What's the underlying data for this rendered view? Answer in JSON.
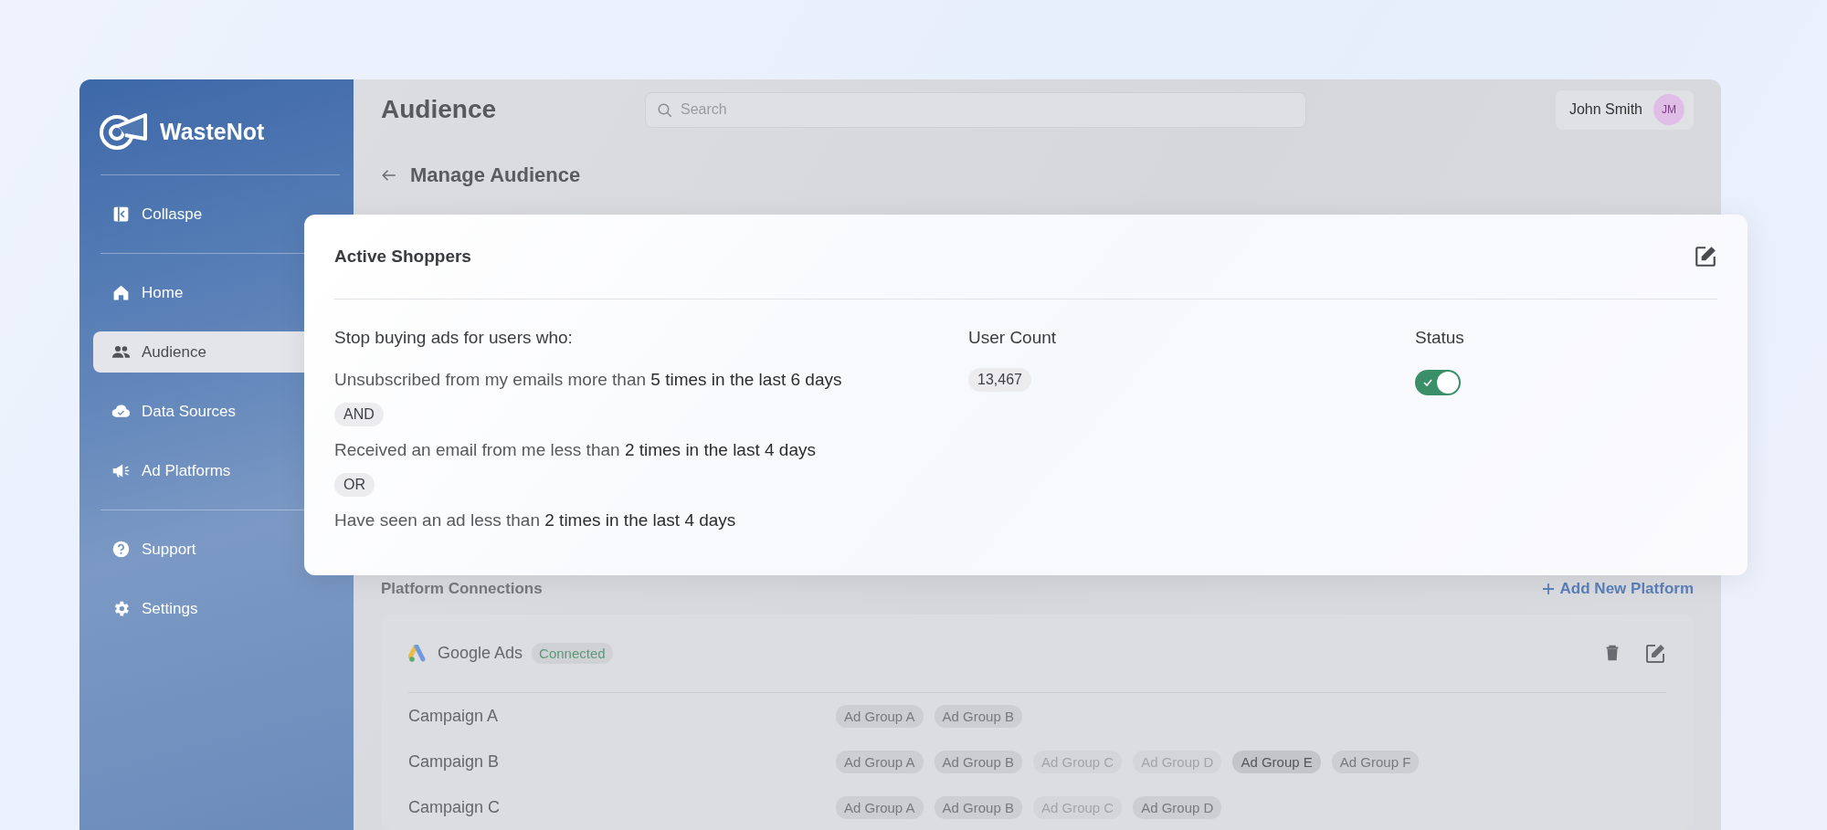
{
  "sidebar": {
    "brand": "WasteNot",
    "collapse": "Collaspe",
    "nav_groups": [
      {
        "items": [
          {
            "label": "Home",
            "kind": "home",
            "selected": false
          },
          {
            "label": "Audience",
            "kind": "people",
            "selected": true
          },
          {
            "label": "Data Sources",
            "kind": "cloud",
            "selected": false
          },
          {
            "label": "Ad Platforms",
            "kind": "megaphone",
            "selected": false
          }
        ]
      },
      {
        "items": [
          {
            "label": "Support",
            "kind": "help",
            "selected": false
          },
          {
            "label": "Settings",
            "kind": "gear",
            "selected": false
          }
        ]
      }
    ]
  },
  "header": {
    "title": "Audience",
    "search": {
      "placeholder": "Search"
    },
    "user": {
      "name": "John Smith",
      "initials": "JM"
    }
  },
  "subheader": {
    "title": "Manage Audience"
  },
  "audience_card": {
    "title": "Active Shoppers",
    "columns": [
      "Stop buying ads for users who:",
      "User Count",
      "Status"
    ],
    "rules": [
      {
        "kind": "rule",
        "text": "Unsubscribed from my emails more than **5 times in the last 6 days**"
      },
      {
        "kind": "operator",
        "text": "AND"
      },
      {
        "kind": "rule",
        "text": "Received an email from me less than **2 times in the last 4 days**"
      },
      {
        "kind": "operator",
        "text": "OR"
      },
      {
        "kind": "rule",
        "text": "Have seen an ad less than **2 times in the last 4 days**"
      }
    ],
    "user_count": "13,467",
    "status": {
      "on": true
    }
  },
  "platforms": {
    "title": "Platform Connections",
    "add_label": "Add New Platform",
    "connections": [
      {
        "name": "Google Ads",
        "status": "Connected",
        "campaigns": [
          {
            "name": "Campaign A",
            "ad_groups": [
              {
                "label": "Ad Group A",
                "disabled": false,
                "selected": false
              },
              {
                "label": "Ad Group B",
                "disabled": false,
                "selected": false
              }
            ]
          },
          {
            "name": "Campaign B",
            "ad_groups": [
              {
                "label": "Ad Group A",
                "disabled": false,
                "selected": false
              },
              {
                "label": "Ad Group B",
                "disabled": false,
                "selected": false
              },
              {
                "label": "Ad Group C",
                "disabled": true,
                "selected": false
              },
              {
                "label": "Ad Group D",
                "disabled": true,
                "selected": false
              },
              {
                "label": "Ad Group E",
                "disabled": false,
                "selected": true
              },
              {
                "label": "Ad Group F",
                "disabled": false,
                "selected": false
              }
            ]
          },
          {
            "name": "Campaign C",
            "ad_groups": [
              {
                "label": "Ad Group A",
                "disabled": false,
                "selected": false
              },
              {
                "label": "Ad Group B",
                "disabled": false,
                "selected": false
              },
              {
                "label": "Ad Group C",
                "disabled": true,
                "selected": false
              },
              {
                "label": "Ad Group D",
                "disabled": false,
                "selected": false
              }
            ]
          }
        ]
      }
    ]
  }
}
